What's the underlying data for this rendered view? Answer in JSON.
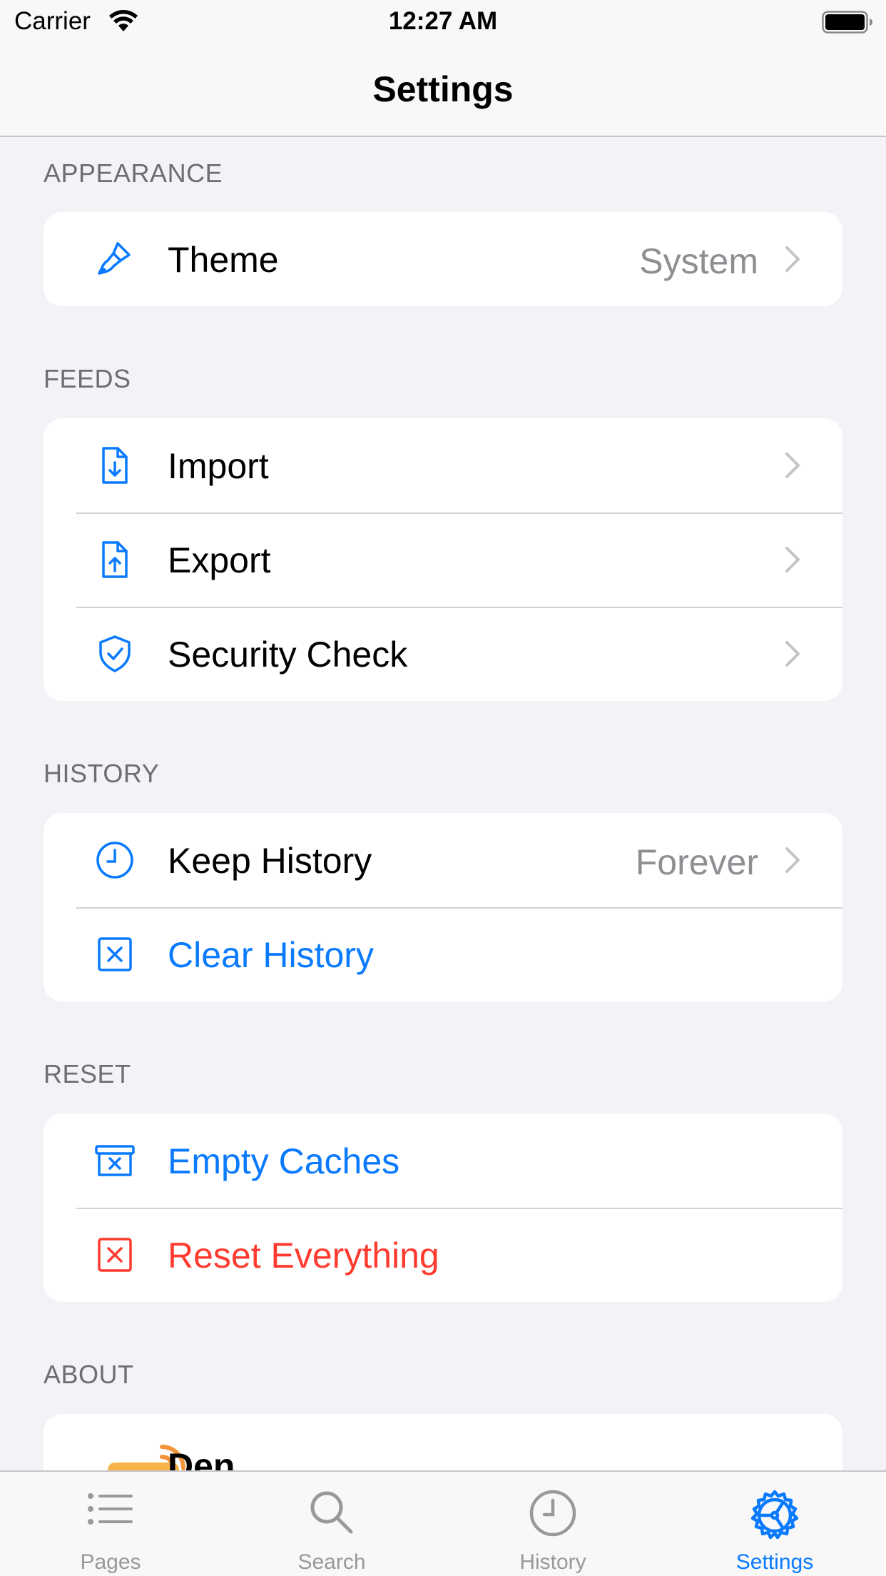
{
  "status_bar": {
    "carrier": "Carrier",
    "time": "12:27 AM"
  },
  "nav": {
    "title": "Settings"
  },
  "sections": {
    "appearance": {
      "header": "APPEARANCE",
      "theme": {
        "label": "Theme",
        "value": "System",
        "icon": "paintbrush-icon"
      }
    },
    "feeds": {
      "header": "FEEDS",
      "import": {
        "label": "Import",
        "icon": "doc-arrow-down-icon"
      },
      "export": {
        "label": "Export",
        "icon": "doc-arrow-up-icon"
      },
      "security": {
        "label": "Security Check",
        "icon": "shield-check-icon"
      }
    },
    "history": {
      "header": "HISTORY",
      "keep": {
        "label": "Keep History",
        "value": "Forever",
        "icon": "clock-icon"
      },
      "clear": {
        "label": "Clear History",
        "icon": "xmark-square-icon"
      }
    },
    "reset": {
      "header": "RESET",
      "caches": {
        "label": "Empty Caches",
        "icon": "archive-x-icon"
      },
      "everything": {
        "label": "Reset Everything",
        "icon": "xmark-square-icon"
      }
    },
    "about": {
      "header": "ABOUT",
      "app": {
        "label": "Den",
        "icon": "app-logo-icon"
      }
    }
  },
  "tabs": [
    {
      "label": "Pages",
      "icon": "list-icon",
      "active": false
    },
    {
      "label": "Search",
      "icon": "magnifier-icon",
      "active": false
    },
    {
      "label": "History",
      "icon": "clock-icon",
      "active": false
    },
    {
      "label": "Settings",
      "icon": "gear-icon",
      "active": true
    }
  ],
  "colors": {
    "accent": "#0a7aff",
    "destructive": "#ff3b30",
    "secondary_text": "#8e8e93",
    "background": "#f2f2f7"
  }
}
